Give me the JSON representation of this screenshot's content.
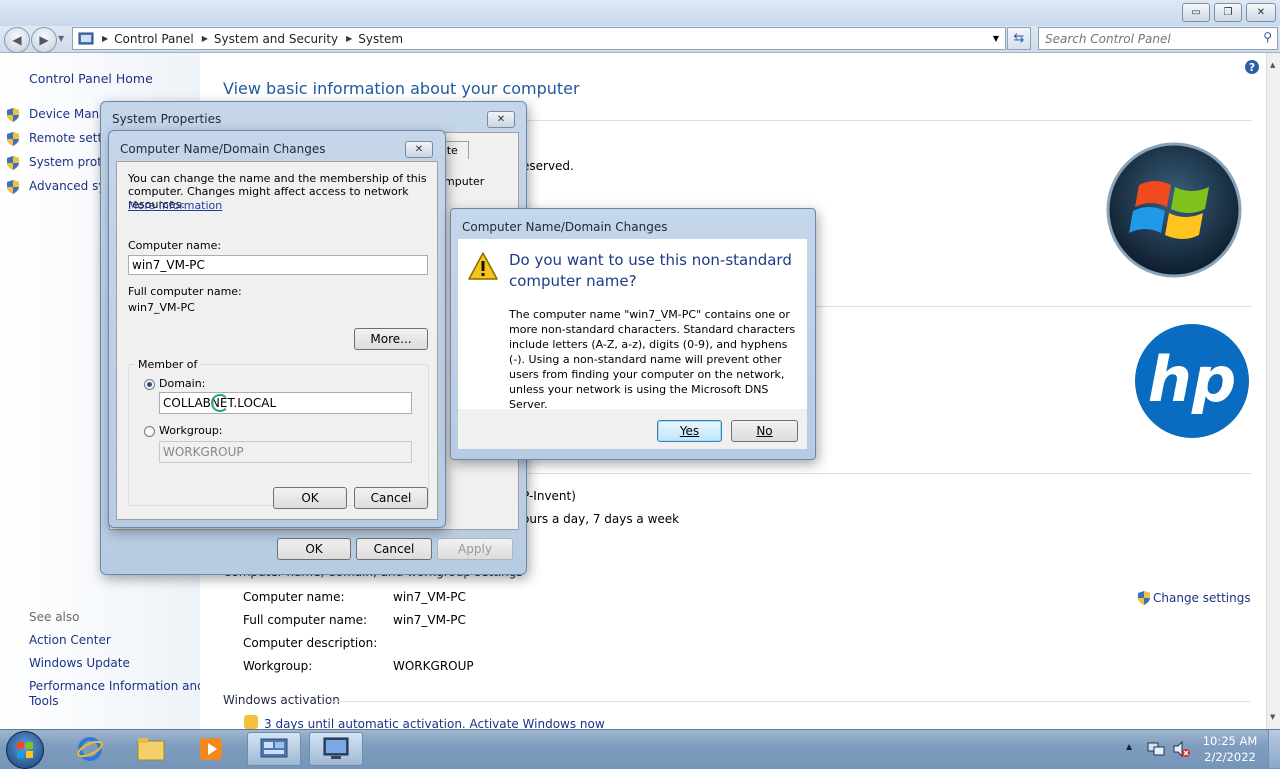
{
  "window": {
    "caption_minimize": "▭",
    "caption_restore": "❐",
    "caption_close": "✕"
  },
  "address": {
    "breadcrumbs": [
      "Control Panel",
      "System and Security",
      "System"
    ],
    "search_placeholder": "Search Control Panel"
  },
  "left_pane": {
    "home": "Control Panel Home",
    "tasks": [
      "Device Manag",
      "Remote settin",
      "System prote",
      "Advanced sys"
    ],
    "see_also_heading": "See also",
    "see_also": [
      "Action Center",
      "Windows Update",
      "Performance Information and",
      "Tools"
    ]
  },
  "main": {
    "title": "View basic information about your computer",
    "reserved_fragment": "eserved.",
    "support_fragment_1": "P-Invent)",
    "support_fragment_2": "ours a day, 7 days a week",
    "computer_section_heading": "Computer name, domain, and workgroup settings",
    "rows": [
      {
        "label": "Computer name:",
        "value": "win7_VM-PC"
      },
      {
        "label": "Full computer name:",
        "value": "win7_VM-PC"
      },
      {
        "label": "Computer description:",
        "value": ""
      },
      {
        "label": "Workgroup:",
        "value": "WORKGROUP"
      }
    ],
    "change_settings": "Change settings",
    "activation_heading": "Windows activation",
    "activation_link": "3 days until automatic activation. Activate Windows now",
    "help_glyph": "?"
  },
  "system_properties": {
    "title": "System Properties",
    "tab_fragment": "ote",
    "computer_fragment": "mputer",
    "ok": "OK",
    "cancel": "Cancel",
    "apply": "Apply"
  },
  "name_changes": {
    "title": "Computer Name/Domain Changes",
    "intro": "You can change the name and the membership of this computer. Changes might affect access to network resources.",
    "more_info": "More information",
    "computer_name_label": "Computer name:",
    "computer_name_value": "win7_VM-PC",
    "full_name_label": "Full computer name:",
    "full_name_value": "win7_VM-PC",
    "more_button": "More...",
    "member_of": "Member of",
    "domain_label": "Domain:",
    "domain_value": "COLLABNET.LOCAL",
    "workgroup_label": "Workgroup:",
    "workgroup_value": "WORKGROUP",
    "ok": "OK",
    "cancel": "Cancel"
  },
  "confirm": {
    "title": "Computer Name/Domain Changes",
    "question": "Do you want to use this non-standard computer name?",
    "body": "The computer name \"win7_VM-PC\" contains one or more non-standard characters. Standard characters include letters (A-Z, a-z), digits (0-9), and hyphens (-). Using a non-standard name will prevent other users from finding your computer on the network, unless your network is using the Microsoft DNS Server.",
    "yes": "Yes",
    "no": "No"
  },
  "logos": {
    "hp_text": "hp"
  },
  "taskbar": {
    "time": "10:25 AM",
    "date": "2/2/2022"
  }
}
